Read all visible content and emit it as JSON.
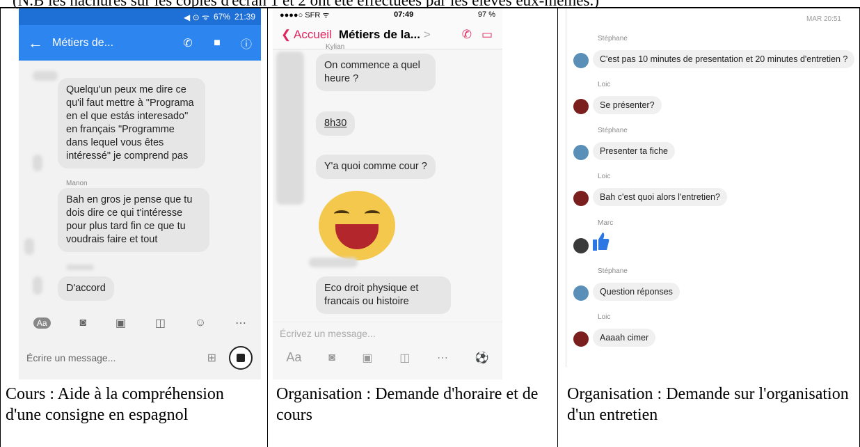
{
  "top_note": "(N.B les hachures sur les copies d'écran 1 et 2 ont été effectuées par les élèves eux-mêmes.)",
  "colors": {
    "fb_blue": "#2d85f0",
    "ios_pink": "#e0245e",
    "bubble_grey": "#e6e6e6",
    "like_blue": "#2b78e4"
  },
  "panel1": {
    "status": {
      "icons": "◀ ⊙ ᯤ",
      "battery": "67%",
      "time": "21:39"
    },
    "header": {
      "back_icon": "arrow-left-icon",
      "title": "Métiers de...",
      "phone_icon": "phone-icon",
      "video_icon": "video-icon",
      "info_icon": "info-icon"
    },
    "messages": [
      {
        "sender": "",
        "text": "Quelqu'un peux me dire ce qu'il faut mettre à \"Programa en el que estás interesado\" en français \"Programme dans lequel vous êtes intéressé\" je comprend pas"
      },
      {
        "sender": "Manon",
        "text": "Bah en gros je pense que tu dois dire ce qui t'intéresse pour plus tard fin ce que tu voudrais faire et tout"
      },
      {
        "sender": "",
        "text": "D'accord"
      }
    ],
    "actions": [
      "Aa",
      "camera-icon",
      "image-icon",
      "gamepad-icon",
      "smiley-icon",
      "more-icon"
    ],
    "input_placeholder": "Écrire un message...",
    "caption": "Cours : Aide à la compréhension d'une consigne en espagnol"
  },
  "panel2": {
    "status": {
      "carrier": "●●●●○ SFR ᯤ",
      "time": "07:49",
      "battery": "97 %"
    },
    "header": {
      "back_label": "Accueil",
      "title": "Métiers de la...",
      "chevron": ">"
    },
    "messages": [
      {
        "sender": "Kylian",
        "text": "On commence a quel heure ?"
      },
      {
        "sender": "",
        "text": "8h30"
      },
      {
        "sender": "",
        "text": "Y'a quoi comme cour ?"
      },
      {
        "sender": "",
        "text": "Eco droit physique et francais ou histoire"
      }
    ],
    "input_placeholder": "Écrivez un message...",
    "actions_aa": "Aa",
    "caption": "Organisation : Demande d'horaire et de cours"
  },
  "panel3": {
    "timestamp": "MAR 20:51",
    "messages": [
      {
        "sender": "Stéphane",
        "text": "C'est pas 10 minutes de presentation et 20 minutes d'entretien ?",
        "avatar": "#5a8fb8"
      },
      {
        "sender": "Loic",
        "text": "Se présenter?",
        "avatar": "#7a1e1e"
      },
      {
        "sender": "Stéphane",
        "text": "Presenter ta fiche",
        "avatar": "#5a8fb8"
      },
      {
        "sender": "Loic",
        "text": "Bah c'est quoi alors l'entretien?",
        "avatar": "#7a1e1e"
      },
      {
        "sender": "Marc",
        "text": "",
        "avatar": "#3a3a3a"
      },
      {
        "sender": "Stéphane",
        "text": "Question réponses",
        "avatar": "#5a8fb8"
      },
      {
        "sender": "Loic",
        "text": "Aaaah cimer",
        "avatar": "#7a1e1e"
      }
    ],
    "caption": "Organisation : Demande sur l'organisation d'un entretien"
  }
}
